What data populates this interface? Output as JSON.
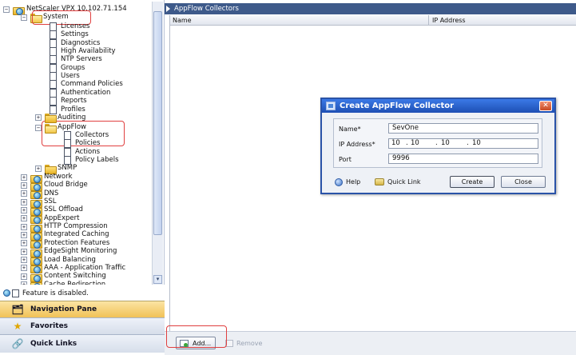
{
  "tree": {
    "root": "NetScaler VPX 10.102.71.154",
    "system": "System",
    "system_children": [
      "Licenses",
      "Settings",
      "Diagnostics",
      "High Availability",
      "NTP Servers",
      "Groups",
      "Users",
      "Command Policies",
      "Authentication",
      "Reports",
      "Profiles",
      "Auditing"
    ],
    "appflow": "AppFlow",
    "appflow_children": [
      "Collectors",
      "Policies",
      "Actions",
      "Policy Labels"
    ],
    "snmp": "SNMP",
    "top_level": [
      "Network",
      "Cloud Bridge",
      "DNS",
      "SSL",
      "SSL Offload",
      "AppExpert",
      "HTTP Compression",
      "Integrated Caching",
      "Protection Features",
      "EdgeSight Monitoring",
      "Load Balancing",
      "AAA - Application Traffic",
      "Content Switching",
      "Cache Redirection"
    ],
    "expand_collapsed": "+",
    "expand_open": "−"
  },
  "status": {
    "feature_disabled": "Feature is disabled."
  },
  "panes": {
    "navigation": "Navigation Pane",
    "favorites": "Favorites",
    "quick_links": "Quick Links"
  },
  "content": {
    "title": "AppFlow Collectors",
    "columns": [
      "Name",
      "IP Address"
    ],
    "add_label": "Add...",
    "remove_label": "Remove"
  },
  "dialog": {
    "title": "Create AppFlow Collector",
    "close_glyph": "✕",
    "name_label": "Name*",
    "name_value": "SevOne",
    "ip_label": "IP Address*",
    "ip_octets": [
      "10",
      "10",
      "10",
      "10"
    ],
    "port_label": "Port",
    "port_value": "9996",
    "help_label": "Help",
    "quick_link_label": "Quick Link",
    "create_label": "Create",
    "close_label": "Close"
  },
  "accent_colors": {
    "title_bar": "#3e5a8a",
    "dialog_title": "#1d4fb4",
    "highlight": "#e04040",
    "nav_pane": "#f1c257"
  }
}
